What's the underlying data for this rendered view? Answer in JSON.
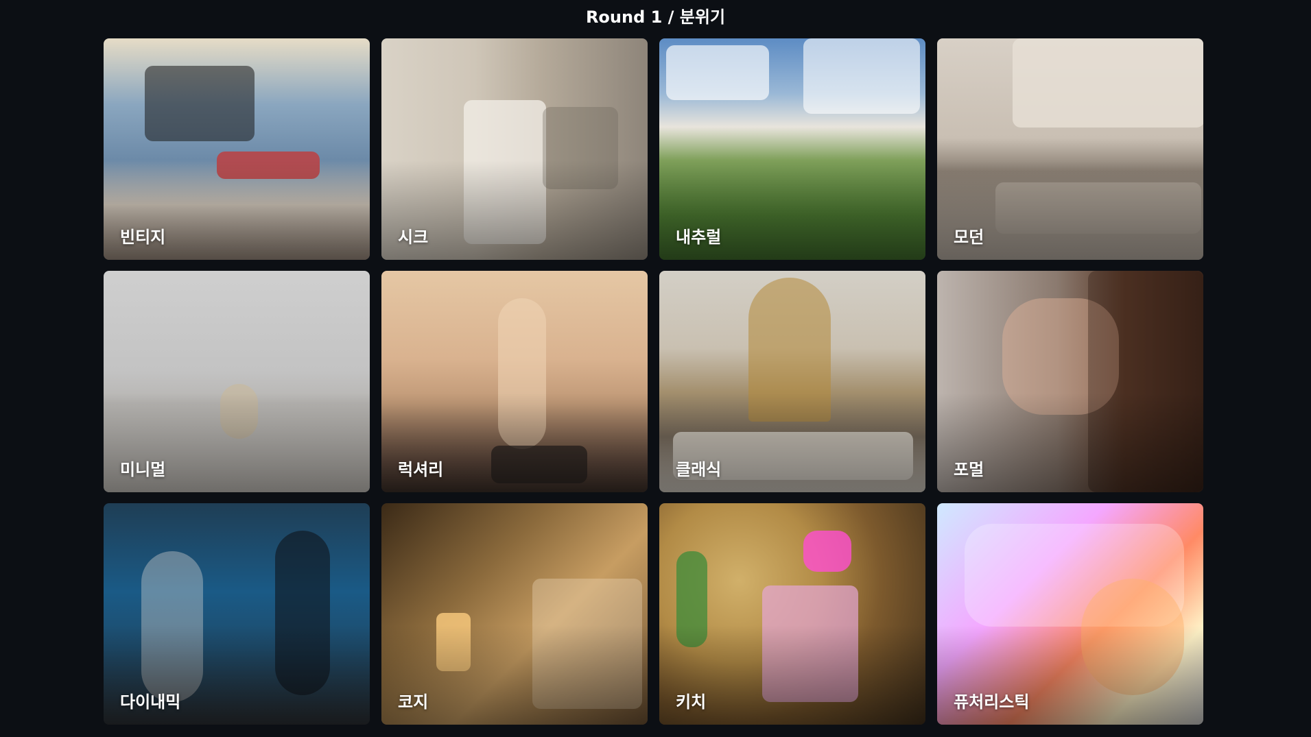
{
  "header": {
    "title": "Round 1 / 분위기"
  },
  "cards": [
    {
      "label": "빈티지"
    },
    {
      "label": "시크"
    },
    {
      "label": "내추럴"
    },
    {
      "label": "모던"
    },
    {
      "label": "미니멀"
    },
    {
      "label": "럭셔리"
    },
    {
      "label": "클래식"
    },
    {
      "label": "포멀"
    },
    {
      "label": "다이내믹"
    },
    {
      "label": "코지"
    },
    {
      "label": "키치"
    },
    {
      "label": "퓨처리스틱"
    }
  ]
}
